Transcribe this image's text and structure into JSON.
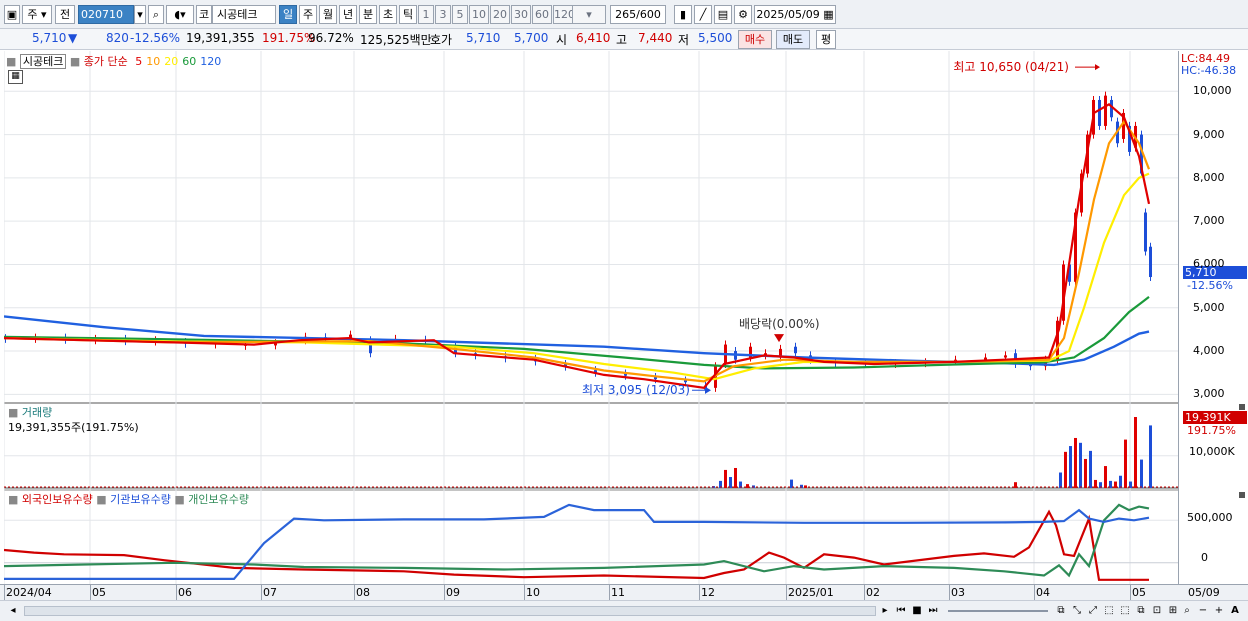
{
  "toolbar": {
    "period_select": "주",
    "prev_label": "전",
    "code": "020710",
    "market": "코",
    "stock_name": "시공테크",
    "period_tabs": [
      "일",
      "주",
      "월",
      "년",
      "분",
      "초",
      "틱"
    ],
    "selected_period": "일",
    "intervals": [
      "1",
      "3",
      "5",
      "10",
      "20",
      "30",
      "60",
      "120"
    ],
    "count": "265",
    "count_total": "/600",
    "date": "2025/05/09"
  },
  "quote": {
    "price": "5,710",
    "change_arrow": "▼",
    "change": "820",
    "change_pct": "-12.56%",
    "volume": "19,391,355",
    "volume_ratio": "191.75%",
    "turnover": "96.72%",
    "amount": "125,525백만",
    "hoga_label": "호가",
    "ask": "5,710",
    "bid": "5,700",
    "open_label": "시",
    "open": "6,410",
    "high_label": "고",
    "high": "7,440",
    "low_label": "저",
    "low": "5,500",
    "buy_button": "매수",
    "sell_button": "매도",
    "eval_button": "평"
  },
  "price_panel": {
    "stock_name": "시공테크",
    "ma_label": "종가 단순",
    "ma_periods": [
      "5",
      "10",
      "20",
      "60",
      "120"
    ],
    "ma_colors": [
      "#e00000",
      "#ff9900",
      "#ffee00",
      "#1a9a3a",
      "#2060e0"
    ],
    "lc": "LC:84.49",
    "hc": "HC:-46.38",
    "y_ticks": [
      "10,000",
      "9,000",
      "8,000",
      "7,000",
      "6,000",
      "5,000",
      "4,000",
      "3,000"
    ],
    "price_tag": "5,710",
    "price_tag_pct": "-12.56%",
    "high_annotation": "최고 10,650 (04/21)",
    "low_annotation": "최저 3,095 (12/03)",
    "dividend_annotation": "배당락(0.00%)"
  },
  "volume_panel": {
    "title": "거래량",
    "value_text": "19,391,355주(191.75%)",
    "tag": "19,391K",
    "tag_pct": "191.75%",
    "y_tick": "10,000K"
  },
  "holdings_panel": {
    "series": [
      "외국인보유수량",
      "기관보유수량",
      "개인보유수량"
    ],
    "series_colors": [
      "#d00000",
      "#2b63d9",
      "#2e8b57"
    ],
    "y_ticks": [
      "500,000",
      "0"
    ]
  },
  "x_axis": {
    "labels": [
      "2024/04",
      "05",
      "06",
      "07",
      "08",
      "09",
      "10",
      "11",
      "12",
      "2025/01",
      "02",
      "03",
      "04",
      "05"
    ],
    "right_label": "05/09"
  },
  "chart_data": {
    "type": "candlestick",
    "price_ylim": [
      2800,
      10700
    ],
    "moving_averages": {
      "ma5": [
        [
          0,
          4300
        ],
        [
          80,
          4250
        ],
        [
          170,
          4200
        ],
        [
          250,
          4150
        ],
        [
          295,
          4250
        ],
        [
          345,
          4300
        ],
        [
          365,
          4200
        ],
        [
          430,
          4250
        ],
        [
          450,
          3950
        ],
        [
          530,
          3800
        ],
        [
          600,
          3450
        ],
        [
          640,
          3350
        ],
        [
          700,
          3150
        ],
        [
          720,
          3700
        ],
        [
          760,
          3900
        ],
        [
          790,
          3850
        ],
        [
          820,
          3750
        ],
        [
          870,
          3700
        ],
        [
          950,
          3750
        ],
        [
          1000,
          3800
        ],
        [
          1045,
          3850
        ],
        [
          1055,
          4500
        ],
        [
          1065,
          6000
        ],
        [
          1075,
          7500
        ],
        [
          1090,
          9500
        ],
        [
          1105,
          9700
        ],
        [
          1120,
          9400
        ],
        [
          1135,
          8500
        ],
        [
          1145,
          7400
        ]
      ],
      "ma10": [
        [
          0,
          4300
        ],
        [
          170,
          4200
        ],
        [
          295,
          4220
        ],
        [
          365,
          4230
        ],
        [
          450,
          4050
        ],
        [
          530,
          3850
        ],
        [
          600,
          3550
        ],
        [
          650,
          3420
        ],
        [
          700,
          3300
        ],
        [
          730,
          3650
        ],
        [
          780,
          3800
        ],
        [
          850,
          3750
        ],
        [
          950,
          3750
        ],
        [
          1045,
          3800
        ],
        [
          1060,
          4300
        ],
        [
          1075,
          5800
        ],
        [
          1090,
          7500
        ],
        [
          1105,
          8800
        ],
        [
          1120,
          9300
        ],
        [
          1135,
          8800
        ],
        [
          1145,
          8200
        ]
      ],
      "ma20": [
        [
          0,
          4300
        ],
        [
          170,
          4220
        ],
        [
          300,
          4200
        ],
        [
          450,
          4100
        ],
        [
          530,
          3950
        ],
        [
          600,
          3700
        ],
        [
          670,
          3500
        ],
        [
          710,
          3350
        ],
        [
          750,
          3600
        ],
        [
          800,
          3750
        ],
        [
          900,
          3730
        ],
        [
          1045,
          3780
        ],
        [
          1065,
          4000
        ],
        [
          1080,
          5000
        ],
        [
          1100,
          6500
        ],
        [
          1120,
          7600
        ],
        [
          1135,
          8000
        ],
        [
          1145,
          8100
        ]
      ],
      "ma60": [
        [
          0,
          4330
        ],
        [
          200,
          4260
        ],
        [
          400,
          4180
        ],
        [
          520,
          4050
        ],
        [
          620,
          3850
        ],
        [
          700,
          3680
        ],
        [
          760,
          3600
        ],
        [
          850,
          3620
        ],
        [
          950,
          3690
        ],
        [
          1040,
          3740
        ],
        [
          1070,
          3850
        ],
        [
          1100,
          4300
        ],
        [
          1125,
          4900
        ],
        [
          1145,
          5250
        ]
      ],
      "ma120": [
        [
          0,
          4800
        ],
        [
          100,
          4550
        ],
        [
          200,
          4350
        ],
        [
          400,
          4250
        ],
        [
          600,
          4100
        ],
        [
          700,
          3950
        ],
        [
          800,
          3850
        ],
        [
          900,
          3780
        ],
        [
          1000,
          3720
        ],
        [
          1050,
          3680
        ],
        [
          1080,
          3800
        ],
        [
          1110,
          4100
        ],
        [
          1135,
          4400
        ],
        [
          1145,
          4450
        ]
      ]
    },
    "candles": [
      [
        0,
        4300,
        4280
      ],
      [
        30,
        4280,
        4310
      ],
      [
        60,
        4310,
        4260
      ],
      [
        90,
        4250,
        4280
      ],
      [
        120,
        4280,
        4230
      ],
      [
        150,
        4220,
        4250
      ],
      [
        180,
        4210,
        4170
      ],
      [
        210,
        4150,
        4180
      ],
      [
        240,
        4120,
        4160
      ],
      [
        270,
        4130,
        4180
      ],
      [
        300,
        4250,
        4330
      ],
      [
        320,
        4320,
        4290
      ],
      [
        345,
        4300,
        4380
      ],
      [
        365,
        4250,
        3950
      ],
      [
        390,
        4240,
        4280
      ],
      [
        420,
        4260,
        4230
      ],
      [
        450,
        4100,
        3950
      ],
      [
        470,
        3950,
        3900
      ],
      [
        500,
        3880,
        3830
      ],
      [
        530,
        3820,
        3760
      ],
      [
        560,
        3700,
        3640
      ],
      [
        590,
        3560,
        3500
      ],
      [
        620,
        3480,
        3430
      ],
      [
        650,
        3400,
        3350
      ],
      [
        680,
        3320,
        3280
      ],
      [
        700,
        3200,
        3110
      ],
      [
        710,
        3150,
        3650
      ],
      [
        720,
        3700,
        4150
      ],
      [
        730,
        4000,
        3800
      ],
      [
        745,
        3850,
        4100
      ],
      [
        760,
        3900,
        3950
      ],
      [
        775,
        3850,
        4050
      ],
      [
        790,
        4100,
        3950
      ],
      [
        805,
        3900,
        3800
      ],
      [
        830,
        3750,
        3720
      ],
      [
        860,
        3720,
        3700
      ],
      [
        890,
        3700,
        3720
      ],
      [
        920,
        3720,
        3740
      ],
      [
        950,
        3760,
        3800
      ],
      [
        980,
        3800,
        3850
      ],
      [
        1000,
        3850,
        3900
      ],
      [
        1010,
        3950,
        3700
      ],
      [
        1025,
        3700,
        3650
      ],
      [
        1040,
        3650,
        3800
      ],
      [
        1052,
        3800,
        4700
      ],
      [
        1058,
        4700,
        6000
      ],
      [
        1064,
        6000,
        5600
      ],
      [
        1070,
        5600,
        7200
      ],
      [
        1076,
        7200,
        8100
      ],
      [
        1082,
        8100,
        9000
      ],
      [
        1088,
        9000,
        9800
      ],
      [
        1094,
        9800,
        9200
      ],
      [
        1100,
        9200,
        9900
      ],
      [
        1106,
        9800,
        9400
      ],
      [
        1112,
        9300,
        8800
      ],
      [
        1118,
        8900,
        9500
      ],
      [
        1124,
        9200,
        8600
      ],
      [
        1130,
        8700,
        9200
      ],
      [
        1136,
        9000,
        8100
      ],
      [
        1140,
        7200,
        6300
      ],
      [
        1145,
        6410,
        5710
      ]
    ],
    "volume_ylim": [
      0,
      22000
    ],
    "volume": [
      [
        708,
        600
      ],
      [
        715,
        2200
      ],
      [
        720,
        5600
      ],
      [
        725,
        3400
      ],
      [
        730,
        6200
      ],
      [
        735,
        2000
      ],
      [
        742,
        1200
      ],
      [
        748,
        800
      ],
      [
        786,
        2600
      ],
      [
        796,
        1000
      ],
      [
        800,
        800
      ],
      [
        1010,
        1800
      ],
      [
        1055,
        4800
      ],
      [
        1060,
        11200
      ],
      [
        1065,
        13000
      ],
      [
        1070,
        15500
      ],
      [
        1075,
        14000
      ],
      [
        1080,
        9000
      ],
      [
        1085,
        11500
      ],
      [
        1090,
        2500
      ],
      [
        1095,
        1800
      ],
      [
        1100,
        6800
      ],
      [
        1105,
        2200
      ],
      [
        1110,
        2000
      ],
      [
        1115,
        3800
      ],
      [
        1120,
        15000
      ],
      [
        1125,
        2000
      ],
      [
        1130,
        22000
      ],
      [
        1136,
        8800
      ],
      [
        1145,
        19391
      ]
    ],
    "holdings_ylim": [
      -250000,
      750000
    ],
    "foreign": [
      [
        0,
        150000
      ],
      [
        30,
        120000
      ],
      [
        60,
        100000
      ],
      [
        120,
        90000
      ],
      [
        160,
        30000
      ],
      [
        230,
        -60000
      ],
      [
        300,
        -80000
      ],
      [
        400,
        -100000
      ],
      [
        450,
        -140000
      ],
      [
        520,
        -170000
      ],
      [
        600,
        -150000
      ],
      [
        700,
        -180000
      ],
      [
        720,
        -120000
      ],
      [
        740,
        -80000
      ],
      [
        765,
        120000
      ],
      [
        780,
        60000
      ],
      [
        800,
        -60000
      ],
      [
        820,
        100000
      ],
      [
        850,
        60000
      ],
      [
        880,
        -20000
      ],
      [
        950,
        80000
      ],
      [
        980,
        110000
      ],
      [
        1010,
        70000
      ],
      [
        1025,
        180000
      ],
      [
        1045,
        600000
      ],
      [
        1052,
        440000
      ],
      [
        1060,
        100000
      ],
      [
        1070,
        80000
      ],
      [
        1085,
        520000
      ],
      [
        1095,
        -200000
      ],
      [
        1145,
        -200000
      ]
    ],
    "institutional": [
      [
        0,
        -190000
      ],
      [
        100,
        -190000
      ],
      [
        200,
        -190000
      ],
      [
        230,
        -190000
      ],
      [
        260,
        230000
      ],
      [
        290,
        520000
      ],
      [
        320,
        500000
      ],
      [
        400,
        510000
      ],
      [
        480,
        510000
      ],
      [
        540,
        540000
      ],
      [
        565,
        680000
      ],
      [
        590,
        620000
      ],
      [
        640,
        620000
      ],
      [
        650,
        480000
      ],
      [
        700,
        480000
      ],
      [
        800,
        470000
      ],
      [
        900,
        470000
      ],
      [
        1000,
        475000
      ],
      [
        1040,
        480000
      ],
      [
        1060,
        490000
      ],
      [
        1075,
        620000
      ],
      [
        1085,
        520000
      ],
      [
        1100,
        480000
      ],
      [
        1115,
        520000
      ],
      [
        1130,
        500000
      ],
      [
        1145,
        530000
      ]
    ],
    "individual": [
      [
        0,
        -40000
      ],
      [
        80,
        -20000
      ],
      [
        170,
        0
      ],
      [
        250,
        -20000
      ],
      [
        300,
        -50000
      ],
      [
        400,
        -60000
      ],
      [
        500,
        -80000
      ],
      [
        600,
        -60000
      ],
      [
        700,
        -20000
      ],
      [
        720,
        20000
      ],
      [
        760,
        -100000
      ],
      [
        790,
        -40000
      ],
      [
        820,
        -80000
      ],
      [
        880,
        -40000
      ],
      [
        950,
        -60000
      ],
      [
        1000,
        -100000
      ],
      [
        1040,
        -150000
      ],
      [
        1055,
        -30000
      ],
      [
        1065,
        -150000
      ],
      [
        1075,
        100000
      ],
      [
        1085,
        -40000
      ],
      [
        1100,
        500000
      ],
      [
        1115,
        680000
      ],
      [
        1125,
        620000
      ],
      [
        1135,
        660000
      ],
      [
        1145,
        640000
      ]
    ]
  }
}
